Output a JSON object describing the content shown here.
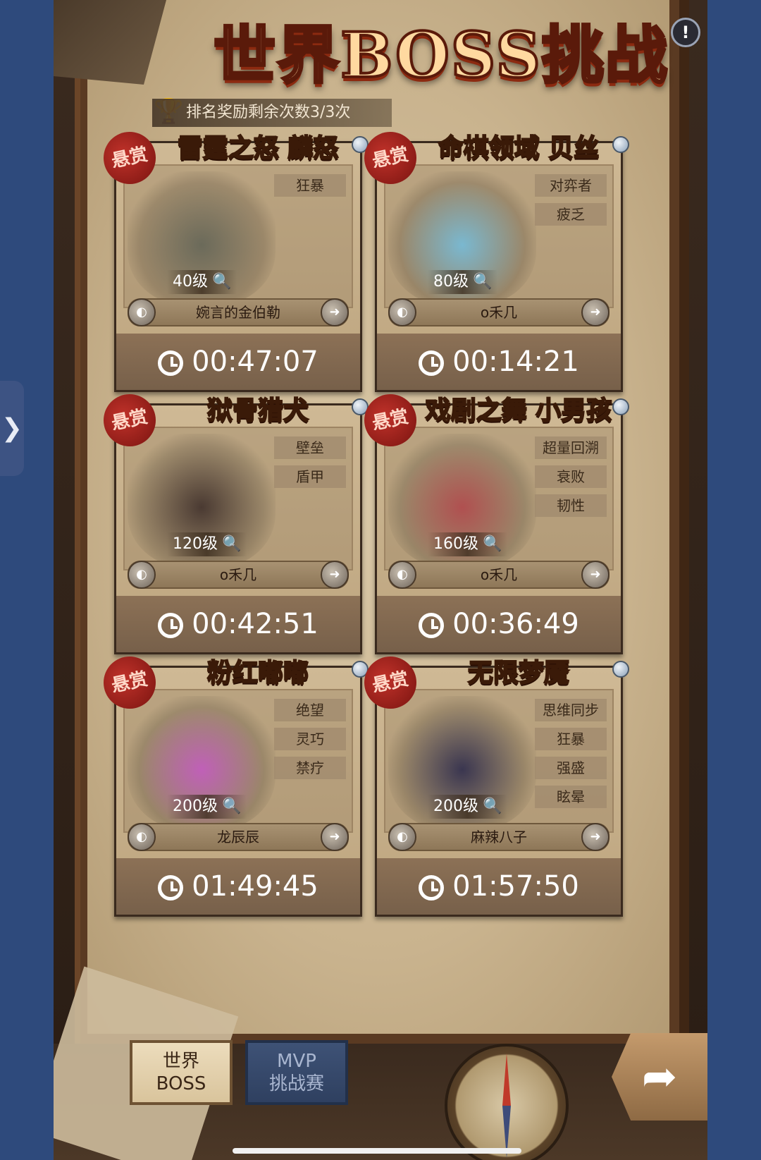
{
  "title": "世界BOSS挑战",
  "info_icon": "!",
  "side_tab_icon": "❯",
  "reward_text": "排名奖励剩余次数3/3次",
  "seal_text": "悬赏",
  "bosses": [
    {
      "name": "雷霆之怒 麟怒",
      "tags": [
        "狂暴"
      ],
      "level": "40级",
      "player": "婉言的金伯勒",
      "timer": "00:47:07",
      "art_color": "#6b6a5a"
    },
    {
      "name": "命棋领域 贝丝",
      "tags": [
        "对弈者",
        "疲乏"
      ],
      "level": "80级",
      "player": "o禾几",
      "timer": "00:14:21",
      "art_color": "#7ab8d0"
    },
    {
      "name": "狱骨猎犬",
      "tags": [
        "壁垒",
        "盾甲"
      ],
      "level": "120级",
      "player": "o禾几",
      "timer": "00:42:51",
      "art_color": "#4a3a32"
    },
    {
      "name": "戏剧之舞 小男孩",
      "tags": [
        "超量回溯",
        "衰败",
        "韧性"
      ],
      "level": "160级",
      "player": "o禾几",
      "timer": "00:36:49",
      "art_color": "#b05050"
    },
    {
      "name": "粉红嘟嘟",
      "tags": [
        "绝望",
        "灵巧",
        "禁疗"
      ],
      "level": "200级",
      "player": "龙辰辰",
      "timer": "01:49:45",
      "art_color": "#c060b8"
    },
    {
      "name": "无限梦魇",
      "tags": [
        "思维同步",
        "狂暴",
        "强盛",
        "眩晕"
      ],
      "level": "200级",
      "player": "麻辣八子",
      "timer": "01:57:50",
      "art_color": "#3a3650"
    }
  ],
  "tabs": {
    "world_boss_line1": "世界",
    "world_boss_line2": "BOSS",
    "mvp_line1": "MVP",
    "mvp_line2": "挑战赛"
  },
  "share_icon": "➦"
}
